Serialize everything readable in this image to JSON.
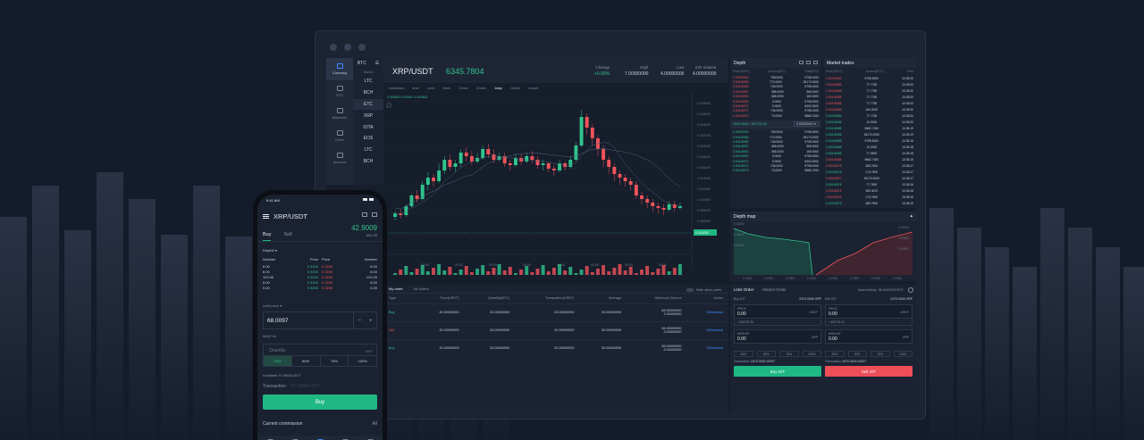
{
  "colors": {
    "green": "#2fc48d",
    "red": "#f0535b",
    "blue": "#3d8bfd",
    "buy_button": "#1fb884",
    "sell_button": "#ee4e58"
  },
  "nav": {
    "items": [
      {
        "label": "Currency",
        "icon": "currency-icon"
      },
      {
        "label": "OTC",
        "icon": "otc-icon"
      },
      {
        "label": "Balances",
        "icon": "balances-icon"
      },
      {
        "label": "Order",
        "icon": "order-icon"
      },
      {
        "label": "Account",
        "icon": "account-icon"
      }
    ]
  },
  "coins": {
    "selected": "BTC",
    "market_label": "Market",
    "list": [
      "LTC",
      "BCH",
      "ETC",
      "XRP",
      "IOTA",
      "EOS",
      "LTC",
      "BCH"
    ]
  },
  "ticker": {
    "pair": "XRP/USDT",
    "price": "6345.7804",
    "change_label": "Change",
    "change_value": "+0.90%",
    "high_label": "High",
    "high_value": "7.00000000",
    "low_label": "Low",
    "low_value": "4.00000000",
    "volume_label": "24h Volume",
    "volume_value": "4.00000000"
  },
  "chart_toolbar": {
    "items": [
      "Indicators",
      "time",
      "1min",
      "5min",
      "15min",
      "30min",
      "1day",
      "1week",
      "month"
    ],
    "active": "1day"
  },
  "chart_indicator": "0.000823 0.000821 0.000821",
  "chart_data": {
    "type": "candlestick",
    "y_ticks": [
      "0.028000",
      "0.026000",
      "0.024000",
      "0.022000",
      "0.020000",
      "0.018000",
      "0.016000",
      "0.014000",
      "0.012000",
      "0.010000",
      "0.008000",
      "0.006000",
      "0.004000"
    ],
    "x_ticks": [
      "00:00",
      "00:00",
      "00:00",
      "00:00",
      "00:00",
      "00:00",
      "00:00",
      "00:00"
    ],
    "last_price_label": "0.004000",
    "candles": [
      [
        40,
        42,
        38,
        43
      ],
      [
        42,
        41,
        39,
        44
      ],
      [
        41,
        46,
        40,
        47
      ],
      [
        46,
        52,
        45,
        53
      ],
      [
        52,
        50,
        48,
        55
      ],
      [
        50,
        58,
        49,
        60
      ],
      [
        58,
        62,
        55,
        65
      ],
      [
        62,
        60,
        57,
        64
      ],
      [
        60,
        66,
        59,
        70
      ],
      [
        66,
        72,
        64,
        74
      ],
      [
        72,
        68,
        66,
        75
      ],
      [
        68,
        70,
        65,
        72
      ],
      [
        70,
        76,
        68,
        78
      ],
      [
        76,
        74,
        71,
        79
      ],
      [
        74,
        71,
        69,
        77
      ],
      [
        71,
        73,
        70,
        76
      ],
      [
        73,
        78,
        72,
        80
      ],
      [
        78,
        75,
        73,
        81
      ],
      [
        75,
        72,
        70,
        78
      ],
      [
        72,
        74,
        71,
        76
      ],
      [
        74,
        70,
        68,
        76
      ],
      [
        70,
        69,
        66,
        72
      ],
      [
        69,
        73,
        68,
        75
      ],
      [
        73,
        71,
        69,
        75
      ],
      [
        71,
        74,
        70,
        76
      ],
      [
        74,
        72,
        70,
        77
      ],
      [
        72,
        69,
        67,
        74
      ],
      [
        69,
        70,
        66,
        72
      ],
      [
        70,
        67,
        65,
        71
      ],
      [
        67,
        66,
        63,
        69
      ],
      [
        66,
        70,
        65,
        72
      ],
      [
        70,
        68,
        66,
        71
      ],
      [
        68,
        72,
        67,
        74
      ],
      [
        72,
        80,
        71,
        82
      ],
      [
        80,
        96,
        79,
        100
      ],
      [
        96,
        90,
        86,
        98
      ],
      [
        90,
        84,
        80,
        92
      ],
      [
        84,
        78,
        74,
        86
      ],
      [
        78,
        72,
        68,
        80
      ],
      [
        72,
        68,
        64,
        74
      ],
      [
        68,
        64,
        60,
        70
      ],
      [
        64,
        62,
        58,
        66
      ],
      [
        62,
        60,
        57,
        64
      ],
      [
        60,
        58,
        55,
        62
      ],
      [
        58,
        52,
        50,
        60
      ],
      [
        52,
        50,
        47,
        54
      ],
      [
        50,
        48,
        45,
        52
      ],
      [
        48,
        46,
        43,
        50
      ],
      [
        46,
        45,
        42,
        48
      ],
      [
        45,
        44,
        41,
        47
      ],
      [
        44,
        47,
        43,
        49
      ],
      [
        47,
        45,
        43,
        49
      ],
      [
        45,
        46,
        44,
        48
      ]
    ]
  },
  "orders": {
    "tabs": [
      "My order",
      "All orders"
    ],
    "hide_label": "Hide other pairs",
    "headers": [
      "Type",
      "Price(USDT)",
      "Quantity(BTC)",
      "Transaction(USDT)",
      "Average",
      "Historical (Source",
      "Action"
    ],
    "rows": [
      {
        "type": "Buy",
        "side": "buy",
        "price": "20.00000000",
        "qty": "20.00000000",
        "trans": "20.00000000",
        "avg": "20.00000000",
        "hist1": "65.00000000",
        "hist2": "3.00000000",
        "action": "Withdrawal"
      },
      {
        "type": "Sell",
        "side": "sell",
        "price": "20.00000000",
        "qty": "20.00000000",
        "trans": "20.00000000",
        "avg": "20.00000000",
        "hist1": "65.00000000",
        "hist2": "3.00000000",
        "action": "Withdrawal"
      },
      {
        "type": "Buy",
        "side": "buy",
        "price": "20.00000000",
        "qty": "20.00000000",
        "trans": "20.00000000",
        "avg": "20.00000000",
        "hist1": "65.00000000",
        "hist2": "3.00000000",
        "action": "Withdrawal"
      }
    ]
  },
  "depth": {
    "title": "Depth",
    "headers": [
      "Price(USDT)",
      "Amount(BTC)",
      "Total(BTC)"
    ],
    "asks": [
      [
        "0.00000000",
        "798.0000",
        "9798.0000"
      ],
      [
        "0.00416983",
        "772.0000",
        "26173.0000"
      ],
      [
        "0.00416983",
        "736.0000",
        "9798.0000"
      ],
      [
        "0.00416987",
        "368.0000",
        "368.0000"
      ],
      [
        "0.00416963",
        "368.0000",
        "160.0000"
      ],
      [
        "0.00416993",
        "0.0000",
        "9798.0000"
      ],
      [
        "0.00416971",
        "0.0000",
        "6000.0000"
      ],
      [
        "0.00416972",
        "736.0000",
        "9798.0000"
      ],
      [
        "0.00416973",
        "73.0000",
        "9886.7000"
      ]
    ],
    "mid_price": "7530.0000 ≈ ¥47702.20",
    "mid_select": "0.00000001",
    "bids": [
      [
        "0.00000000",
        "798.0000",
        "9798.0000"
      ],
      [
        "0.00416983",
        "772.0000",
        "26173.0000"
      ],
      [
        "0.00416983",
        "736.0000",
        "9798.0000"
      ],
      [
        "0.00416987",
        "368.0000",
        "368.0000"
      ],
      [
        "0.00416963",
        "368.0000",
        "160.0000"
      ],
      [
        "0.00416993",
        "0.0000",
        "9798.0000"
      ],
      [
        "0.00416971",
        "0.0000",
        "6000.0000"
      ],
      [
        "0.00416972",
        "736.0000",
        "9798.0000"
      ],
      [
        "0.00416973",
        "73.0000",
        "9886.7000"
      ]
    ]
  },
  "trades": {
    "title": "Market trades",
    "headers": [
      "Price(USDT)",
      "Amount(BTC)",
      "Time"
    ],
    "rows": [
      [
        "0.00416983",
        "9798.8000",
        "10:35:20",
        "r"
      ],
      [
        "0.00416988",
        "77.7750",
        "10:35:20",
        "r"
      ],
      [
        "0.00416988",
        "77.7750",
        "10:35:20",
        "r"
      ],
      [
        "0.00416988",
        "77.7750",
        "10:35:20",
        "r"
      ],
      [
        "0.00416988",
        "77.7750",
        "10:35:20",
        "r"
      ],
      [
        "0.00416988",
        "160.0000",
        "10:35:20",
        "r"
      ],
      [
        "0.00416985",
        "77.7750",
        "10:35:20",
        "g"
      ],
      [
        "0.00416988",
        "10.0000",
        "10:35:20",
        "g"
      ],
      [
        "0.00416988",
        "9662.7000",
        "10:35:19",
        "g"
      ],
      [
        "0.00416988",
        "26173.0000",
        "10:35:19",
        "g"
      ],
      [
        "0.00416988",
        "9798.8000",
        "10:35:18",
        "g"
      ],
      [
        "0.00416988",
        "10.0000",
        "10:35:18",
        "g"
      ],
      [
        "0.00416988",
        "77.9800",
        "10:35:18",
        "g"
      ],
      [
        "0.00416988",
        "9662.7000",
        "10:35:18",
        "r"
      ],
      [
        "0.00416978",
        "389.7800",
        "10:35:17",
        "r"
      ],
      [
        "0.00416978",
        "173.7800",
        "10:35:17",
        "g"
      ],
      [
        "0.00416970",
        "26173.0000",
        "10:35:17",
        "r"
      ],
      [
        "0.00416978",
        "77.7800",
        "10:35:16",
        "g"
      ],
      [
        "0.00416978",
        "389.4670",
        "10:35:16",
        "r"
      ],
      [
        "0.00416978",
        "173.7800",
        "10:35:16",
        "r"
      ],
      [
        "0.00416978",
        "389.7800",
        "10:35:15",
        "g"
      ]
    ]
  },
  "depth_map": {
    "title": "Depth map",
    "y_left": [
      "0.00000",
      "0.00000",
      "0.00000"
    ],
    "y_right": [
      "0.00000",
      "0.00000",
      "0.00000"
    ],
    "x_ticks": [
      "0.1900",
      "0.1900",
      "0.1900",
      "0.1900",
      "0.1900",
      "0.1900",
      "0.1900",
      "0.1900"
    ]
  },
  "limit": {
    "tabs": [
      "Limit Order",
      "Market Order"
    ],
    "fee_label": "Asset Activity: 35.00400023 BTC",
    "buy": {
      "bal_label": "Buy IOT",
      "bal_value": "2470.0000 XRP",
      "price_label": "PRICE",
      "price_value": "0.00",
      "price_unit": "USDT",
      "hint": "≈ ¥43702.20",
      "amount_label": "AMOUNT",
      "amount_value": "0.00",
      "amount_unit": "XRP",
      "pcts": [
        "25%",
        "50%",
        "75%",
        "100%"
      ],
      "trans_label": "Transaction",
      "trans_value": "2470.0000 USDT",
      "button": "Buy IOT"
    },
    "sell": {
      "bal_label": "Sell IOT",
      "bal_value": "2470.0000 XRP",
      "price_label": "PRICE",
      "price_value": "0.00",
      "price_unit": "USDT",
      "hint": "≈ ¥43702.20",
      "amount_label": "AMOUNT",
      "amount_value": "0.00",
      "amount_unit": "XRP",
      "pcts": [
        "25%",
        "50%",
        "75%",
        "100%"
      ],
      "trans_label": "Transaction",
      "trans_value": "2470.0000 USDT",
      "button": "Sell IOT"
    }
  },
  "phone": {
    "time": "9:41 AM",
    "pair": "XRP/USDT",
    "price": "42.9009",
    "price_sub": "¥63.35",
    "tabs": [
      "Buy",
      "Sell"
    ],
    "depth_label": "Depth2 ▾",
    "ob_headers": [
      "Number",
      "Price",
      "Price",
      "Number"
    ],
    "ob_rows": [
      [
        "8.00",
        "0.3200",
        "0.3200",
        "8.00"
      ],
      [
        "8.00",
        "0.3200",
        "0.3200",
        "8.00"
      ],
      [
        "120.00",
        "0.3200",
        "0.3200",
        "120.00"
      ],
      [
        "8.00",
        "0.3200",
        "0.3200",
        "8.00"
      ],
      [
        "0.00",
        "0.3200",
        "0.3200",
        "0.00"
      ]
    ],
    "limit_label": "Limit price ▾",
    "limit_value": "68.0097",
    "limit_hint": "¥6347.84",
    "qty_placeholder": "Quantity",
    "qty_unit": "XRP",
    "pcts": [
      "25%",
      "50%",
      "75%",
      "100%"
    ],
    "available": "Available 37.8008USDT",
    "trans_label": "Transaction",
    "trans_value": "257.0048USDT",
    "buy_button": "Buy",
    "commission_label": "Current commission",
    "commission_all": "All"
  }
}
